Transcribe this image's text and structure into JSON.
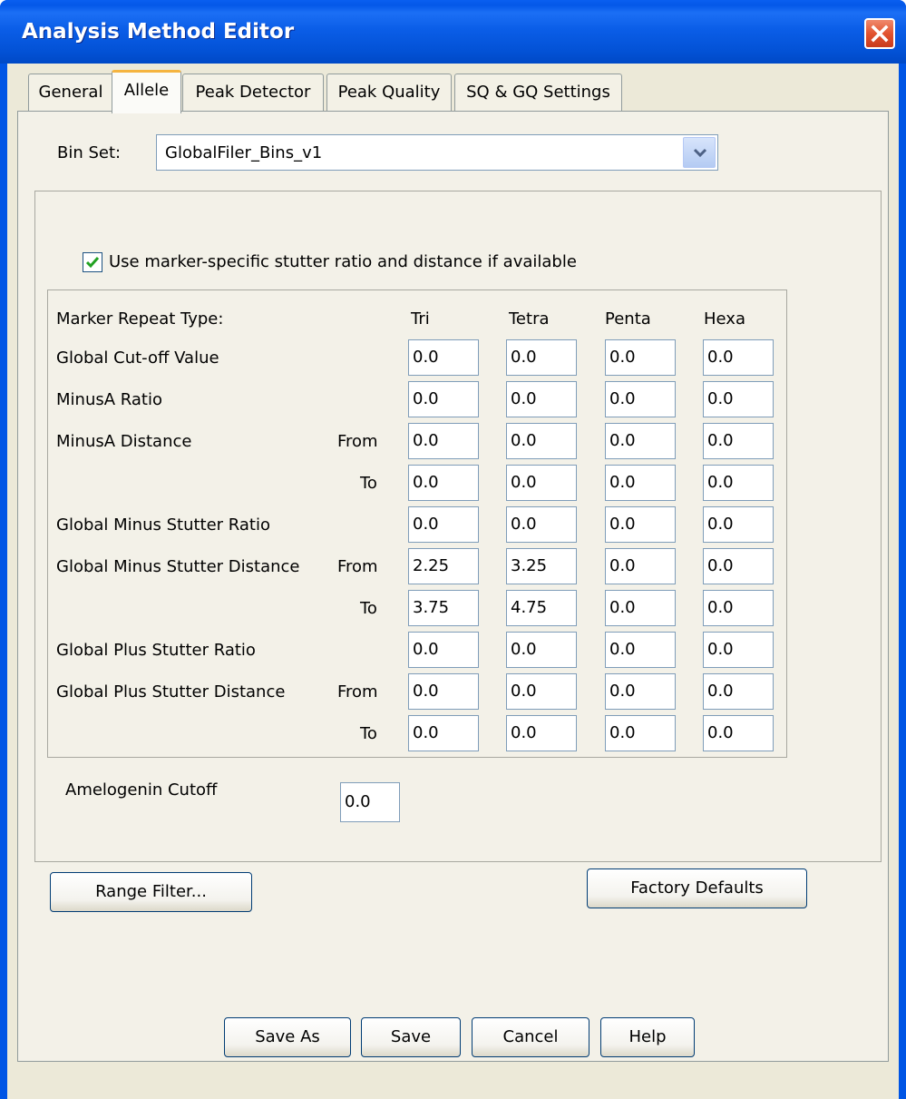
{
  "window": {
    "title": "Analysis Method Editor"
  },
  "tabs": [
    {
      "label": "General",
      "active": false
    },
    {
      "label": "Allele",
      "active": true
    },
    {
      "label": "Peak Detector",
      "active": false
    },
    {
      "label": "Peak Quality",
      "active": false
    },
    {
      "label": "SQ & GQ Settings",
      "active": false
    }
  ],
  "bin_set": {
    "label": "Bin Set:",
    "value": "GlobalFiler_Bins_v1"
  },
  "stutter_checkbox": {
    "label": "Use marker-specific stutter ratio and distance if available",
    "checked": true
  },
  "table": {
    "row_header": "Marker Repeat Type:",
    "columns": [
      "Tri",
      "Tetra",
      "Penta",
      "Hexa"
    ],
    "rows": [
      {
        "label": "Global Cut-off Value",
        "sub": "",
        "values": [
          "0.0",
          "0.0",
          "0.0",
          "0.0"
        ]
      },
      {
        "label": "MinusA Ratio",
        "sub": "",
        "values": [
          "0.0",
          "0.0",
          "0.0",
          "0.0"
        ]
      },
      {
        "label": "MinusA Distance",
        "sub": "From",
        "values": [
          "0.0",
          "0.0",
          "0.0",
          "0.0"
        ]
      },
      {
        "label": "",
        "sub": "To",
        "values": [
          "0.0",
          "0.0",
          "0.0",
          "0.0"
        ]
      },
      {
        "label": "Global Minus Stutter Ratio",
        "sub": "",
        "values": [
          "0.0",
          "0.0",
          "0.0",
          "0.0"
        ]
      },
      {
        "label": "Global Minus Stutter Distance",
        "sub": "From",
        "values": [
          "2.25",
          "3.25",
          "0.0",
          "0.0"
        ]
      },
      {
        "label": "",
        "sub": "To",
        "values": [
          "3.75",
          "4.75",
          "0.0",
          "0.0"
        ]
      },
      {
        "label": "Global Plus Stutter Ratio",
        "sub": "",
        "values": [
          "0.0",
          "0.0",
          "0.0",
          "0.0"
        ]
      },
      {
        "label": "Global Plus Stutter Distance",
        "sub": "From",
        "values": [
          "0.0",
          "0.0",
          "0.0",
          "0.0"
        ]
      },
      {
        "label": "",
        "sub": "To",
        "values": [
          "0.0",
          "0.0",
          "0.0",
          "0.0"
        ]
      }
    ]
  },
  "amelogenin": {
    "label": "Amelogenin Cutoff",
    "value": "0.0"
  },
  "buttons": {
    "range_filter": "Range Filter...",
    "factory_defaults": "Factory Defaults",
    "save_as": "Save As",
    "save": "Save",
    "cancel": "Cancel",
    "help": "Help"
  },
  "colors": {
    "titlebar": "#0055e5",
    "client": "#ece9d8",
    "active_tab_accent": "#f5b440",
    "close_button": "#e2532f"
  }
}
